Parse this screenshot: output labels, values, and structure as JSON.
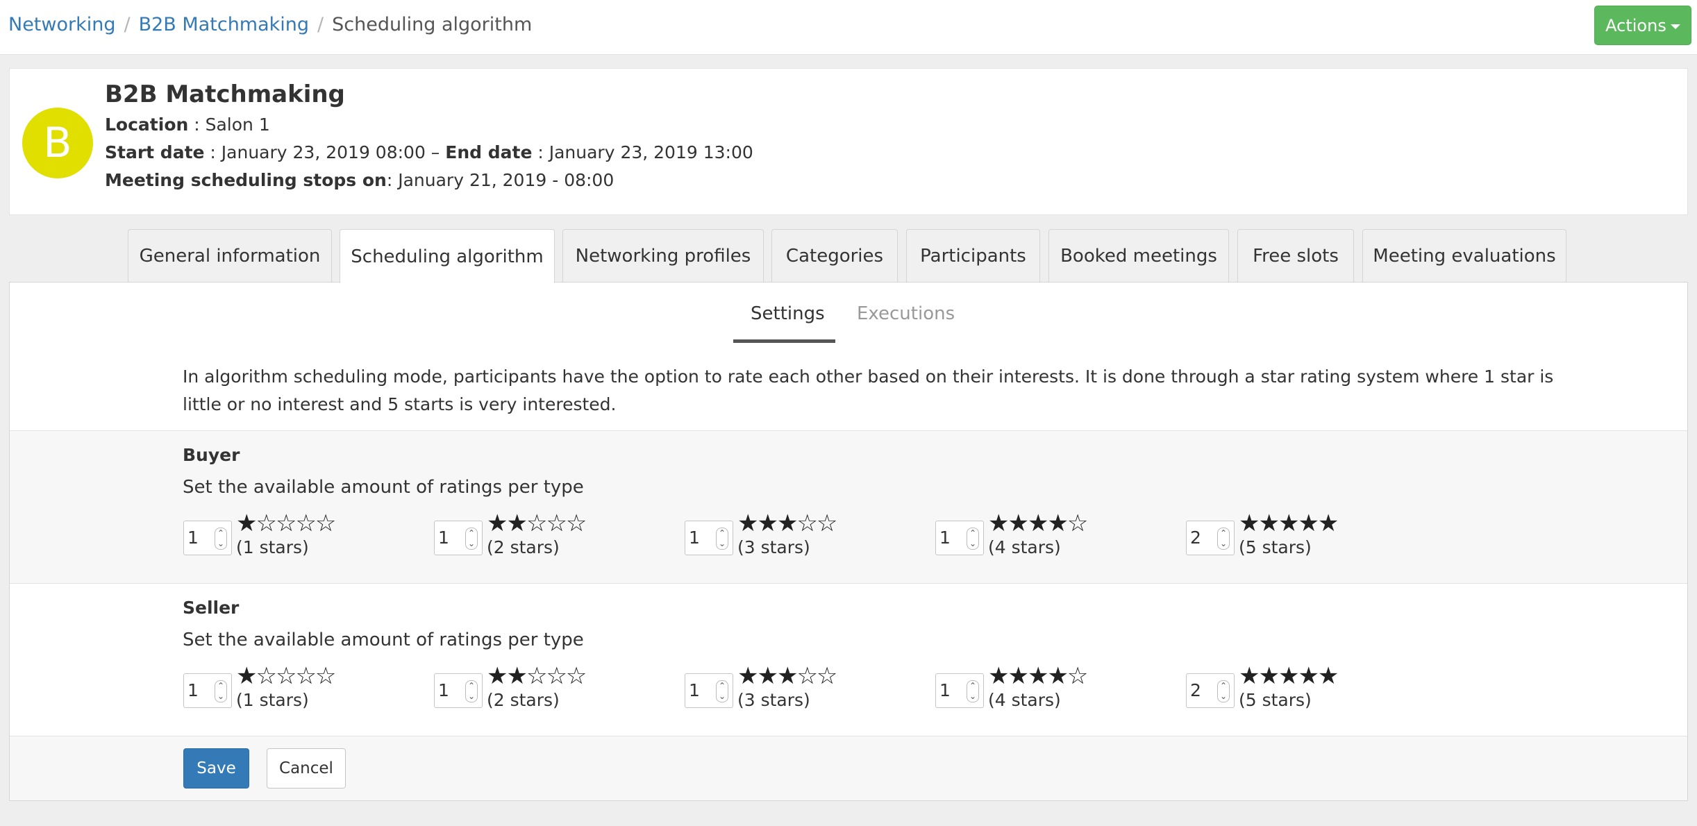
{
  "breadcrumb": {
    "items": [
      "Networking",
      "B2B Matchmaking"
    ],
    "separator": "/",
    "current": "Scheduling algorithm"
  },
  "header": {
    "actions_label": "Actions"
  },
  "event": {
    "avatar_letter": "B",
    "avatar_color": "#e0df00",
    "title": "B2B Matchmaking",
    "location_label": "Location",
    "location_value": " : Salon 1",
    "start_label": "Start date",
    "start_value": " : January 23, 2019 08:00 – ",
    "end_label": "End date",
    "end_value": " : January 23, 2019 13:00",
    "stops_label": "Meeting scheduling stops on",
    "stops_value": ": January 21, 2019 - 08:00"
  },
  "tabs": [
    {
      "label": "General information"
    },
    {
      "label": "Scheduling algorithm",
      "active": true
    },
    {
      "label": "Networking profiles"
    },
    {
      "label": "Categories"
    },
    {
      "label": "Participants"
    },
    {
      "label": "Booked meetings"
    },
    {
      "label": "Free slots"
    },
    {
      "label": "Meeting evaluations"
    }
  ],
  "subtabs": {
    "settings": "Settings",
    "executions": "Executions"
  },
  "intro": "In algorithm scheduling mode, participants have the option to rate each other based on their interests. It is done through a star rating system where 1 star is little or no interest and 5 starts is very interested.",
  "buyer": {
    "title": "Buyer",
    "subtitle": "Set the available amount of ratings per type",
    "ratings": [
      {
        "value": "1",
        "stars": "★☆☆☆☆",
        "label": "(1 stars)"
      },
      {
        "value": "1",
        "stars": "★★☆☆☆",
        "label": "(2 stars)"
      },
      {
        "value": "1",
        "stars": "★★★☆☆",
        "label": "(3 stars)"
      },
      {
        "value": "1",
        "stars": "★★★★☆",
        "label": "(4 stars)"
      },
      {
        "value": "2",
        "stars": "★★★★★",
        "label": "(5 stars)"
      }
    ]
  },
  "seller": {
    "title": "Seller",
    "subtitle": "Set the available amount of ratings per type",
    "ratings": [
      {
        "value": "1",
        "stars": "★☆☆☆☆",
        "label": "(1 stars)"
      },
      {
        "value": "1",
        "stars": "★★☆☆☆",
        "label": "(2 stars)"
      },
      {
        "value": "1",
        "stars": "★★★☆☆",
        "label": "(3 stars)"
      },
      {
        "value": "1",
        "stars": "★★★★☆",
        "label": "(4 stars)"
      },
      {
        "value": "2",
        "stars": "★★★★★",
        "label": "(5 stars)"
      }
    ]
  },
  "footer": {
    "save_label": "Save",
    "cancel_label": "Cancel"
  }
}
